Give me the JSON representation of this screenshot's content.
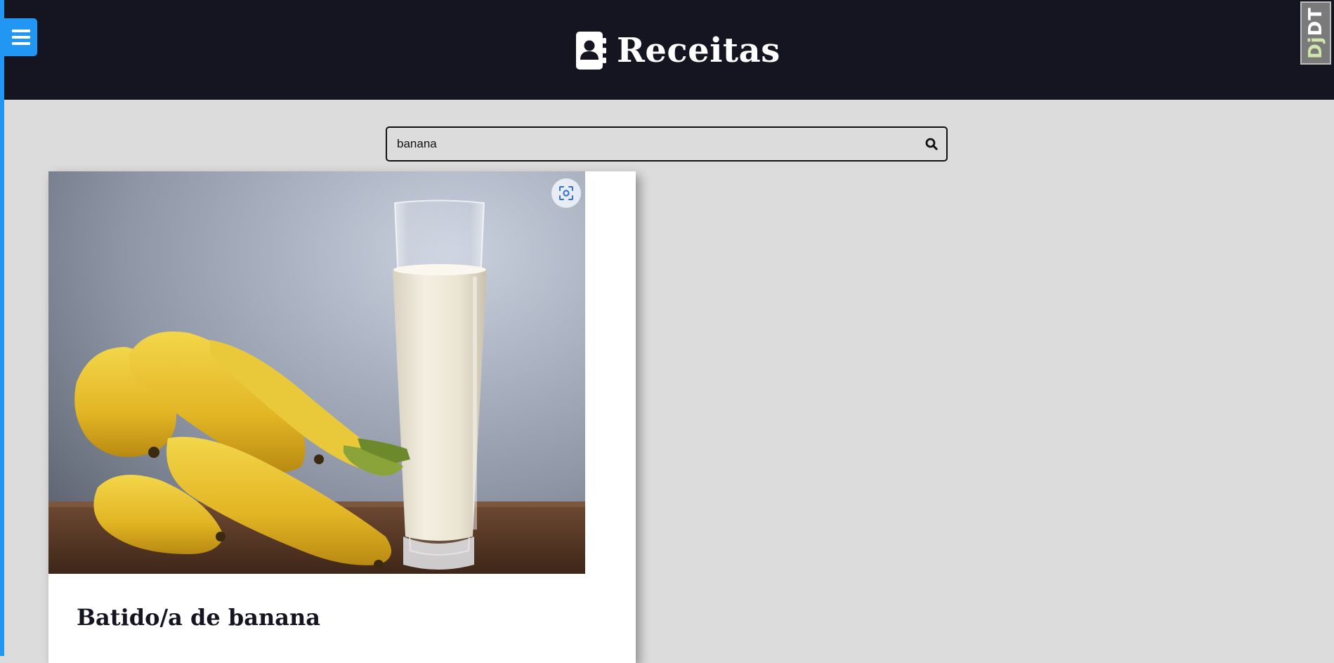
{
  "header": {
    "title": "Receitas",
    "brand_icon": "contact-book-icon",
    "menu_icon": "hamburger-menu-icon",
    "background": "#151521",
    "accent": "#2196f3"
  },
  "debug_toolbar": {
    "label_dj": "Dj",
    "label_dt": "DT"
  },
  "search": {
    "value": "banana",
    "icon": "search-icon"
  },
  "results": [
    {
      "title": "Batido/a de banana",
      "image_alt": "Bananas and a glass of banana smoothie",
      "zoom_icon": "image-search-icon"
    }
  ]
}
